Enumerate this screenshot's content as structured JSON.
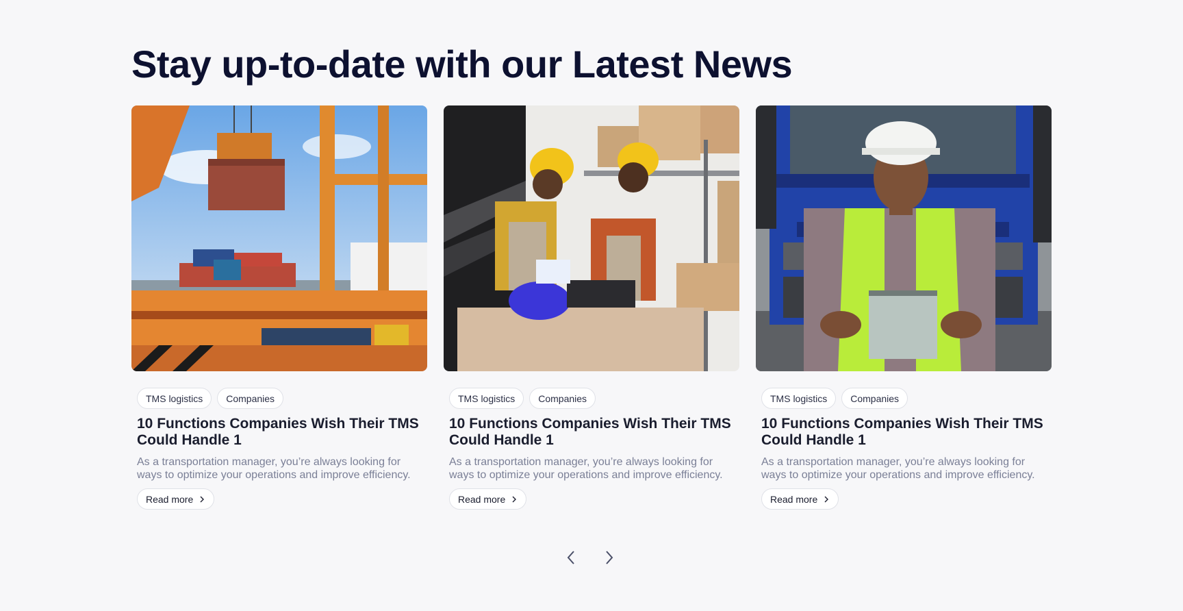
{
  "section": {
    "title": "Stay up-to-date with our Latest News"
  },
  "cards": [
    {
      "image_alt": "Port crane lifting shipping container",
      "tags": [
        "TMS logistics",
        "Companies"
      ],
      "title": "10 Functions Companies Wish Their TMS Could Handle 1",
      "description": "As a transportation manager, you’re always looking for ways to optimize your operations and improve efficiency.",
      "cta": "Read more"
    },
    {
      "image_alt": "Warehouse workers in hard hats inspecting a package",
      "tags": [
        "TMS logistics",
        "Companies"
      ],
      "title": "10 Functions Companies Wish Their TMS Could Handle 1",
      "description": "As a transportation manager, you’re always looking for ways to optimize your operations and improve efficiency.",
      "cta": "Read more"
    },
    {
      "image_alt": "Worker in safety vest holding clipboard in front of truck",
      "tags": [
        "TMS logistics",
        "Companies"
      ],
      "title": "10 Functions Companies Wish Their TMS Could Handle 1",
      "description": "As a transportation manager, you’re always looking for ways to optimize your operations and improve efficiency.",
      "cta": "Read more"
    }
  ],
  "pager": {
    "prev_icon": "chevron-left-icon",
    "next_icon": "chevron-right-icon"
  },
  "colors": {
    "background": "#f7f7f9",
    "heading": "#0d1130",
    "description": "#7a7f96"
  }
}
